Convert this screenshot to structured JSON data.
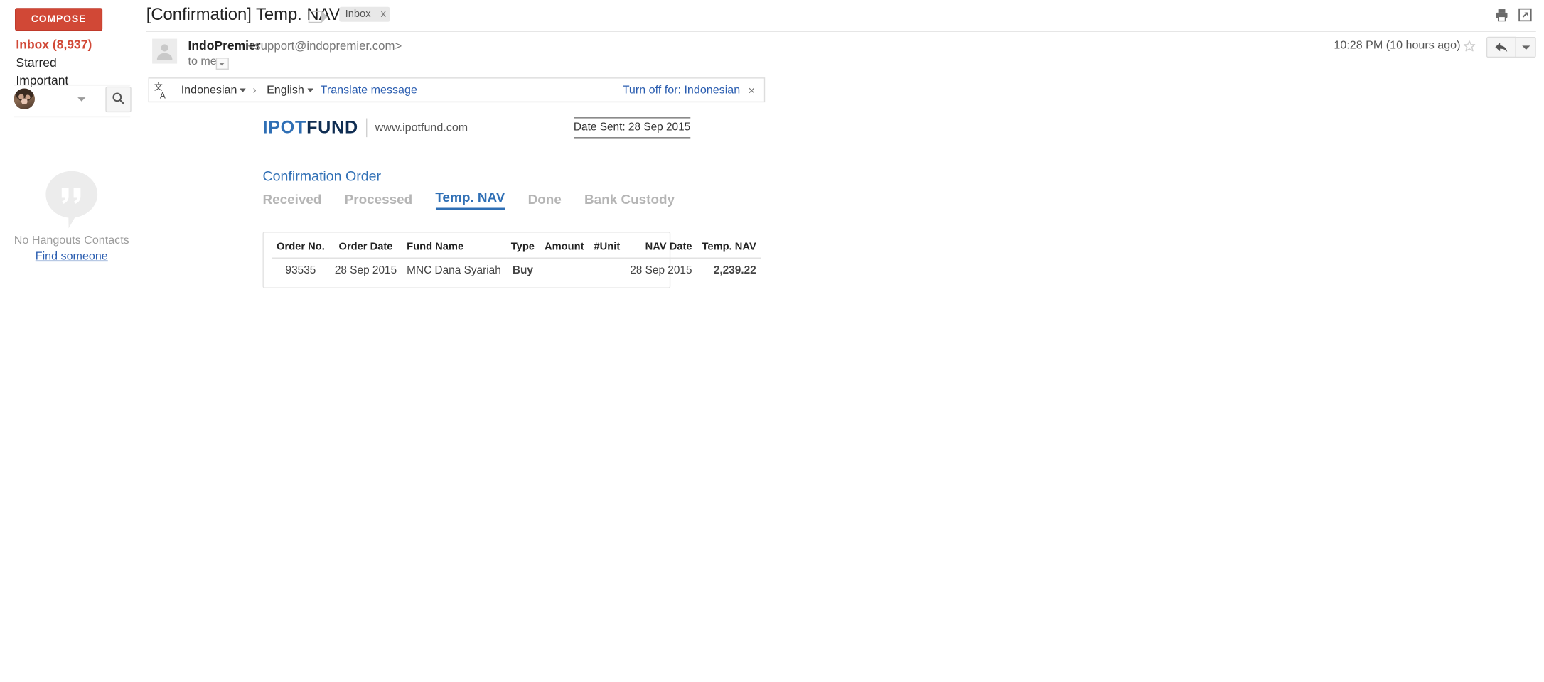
{
  "sidebar": {
    "compose_label": "COMPOSE",
    "nav_items": [
      {
        "label": "Inbox (8,937)",
        "active": true
      },
      {
        "label": "Starred",
        "active": false
      },
      {
        "label": "Important",
        "active": false
      }
    ],
    "hangouts": {
      "name_placeholder": "",
      "empty_text": "No Hangouts Contacts",
      "find_link": "Find someone",
      "search_icon": "search-icon",
      "avatar_icon": "user-avatar"
    }
  },
  "header": {
    "subject": "[Confirmation] Temp. NAV",
    "label_chip": "Inbox",
    "label_chip_remove": "x",
    "print_icon": "print-icon",
    "popout_icon": "open-in-new-window-icon"
  },
  "message": {
    "sender_name": "IndoPremier",
    "sender_email": "<support@indopremier.com>",
    "recipient": "to me",
    "timestamp": "10:28 PM (10 hours ago)",
    "star_icon": "star-icon",
    "reply_icon": "reply-icon",
    "more_icon": "chevron-down-icon"
  },
  "translate": {
    "icon": "translate-icon",
    "source_language": "Indonesian",
    "arrow": "›",
    "target_language": "English",
    "translate_link": "Translate message",
    "turn_off_link": "Turn off for: Indonesian",
    "close_icon": "×"
  },
  "email": {
    "brand_first": "IPOT",
    "brand_second": "FUND",
    "website": "www.ipotfund.com",
    "date_sent": "Date Sent: 28 Sep 2015",
    "section_title": "Confirmation Order",
    "tabs": [
      {
        "label": "Received",
        "active": false
      },
      {
        "label": "Processed",
        "active": false
      },
      {
        "label": "Temp. NAV",
        "active": true
      },
      {
        "label": "Done",
        "active": false
      },
      {
        "label": "Bank Custody",
        "active": false
      }
    ],
    "table": {
      "columns": [
        "Order No.",
        "Order Date",
        "Fund Name",
        "Type",
        "Amount",
        "#Unit",
        "NAV Date",
        "Temp. NAV"
      ],
      "rows": [
        {
          "order_no": "93535",
          "order_date": "28 Sep 2015",
          "fund_name": "MNC Dana Syariah",
          "type": "Buy",
          "amount": "",
          "unit": "",
          "nav_date": "28 Sep 2015",
          "temp_nav": "2,239.22"
        }
      ]
    }
  },
  "colors": {
    "compose_red": "#d14836",
    "inbox_red": "#d14836",
    "brand_blue": "#2f6fb5",
    "brand_navy": "#0f2d52",
    "link_blue": "#2a5db0",
    "buy_green": "#2e7d32",
    "tab_inactive": "#b5b5b5"
  }
}
